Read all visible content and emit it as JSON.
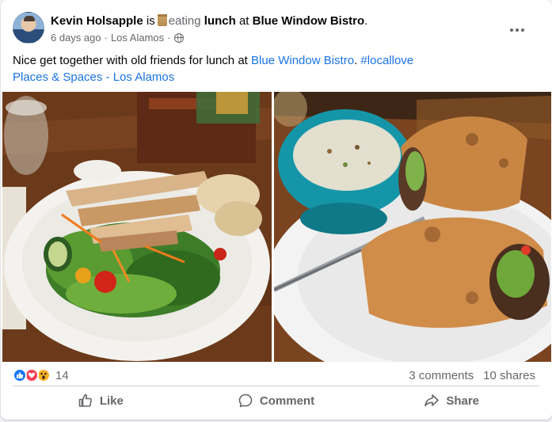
{
  "post": {
    "author": "Kevin Holsapple",
    "is": "is",
    "feeling": "eating",
    "activity": "lunch",
    "at": "at",
    "place": "Blue Window Bistro",
    "period": ".",
    "time": "6 days ago",
    "separator": "·",
    "location": "Los Alamos",
    "separator2": "·",
    "text_prefix": "Nice get together with old friends for lunch at",
    "text_link": "Blue Window Bistro",
    "text_period": ".",
    "hashtag": "#locallove",
    "page_link": "Places & Spaces - Los Alamos"
  },
  "photos": [
    {
      "icon": "salad-photo"
    },
    {
      "icon": "soup-and-wrap-photo"
    }
  ],
  "stats": {
    "reaction_count": "14",
    "comments": "3 comments",
    "shares": "10 shares"
  },
  "actions": {
    "like": "Like",
    "comment": "Comment",
    "share": "Share"
  },
  "colors": {
    "link": "#1b74e4",
    "like": "#1877f2",
    "love": "#f33e58",
    "wow": "#f7b125",
    "secondary_text": "#65676b"
  }
}
